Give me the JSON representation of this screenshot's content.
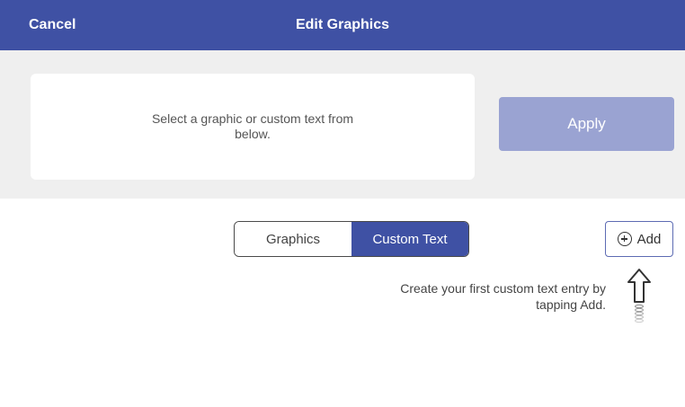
{
  "header": {
    "cancel_label": "Cancel",
    "title": "Edit Graphics"
  },
  "preview": {
    "message": "Select a graphic or custom text from below."
  },
  "apply_label": "Apply",
  "tabs": [
    {
      "label": "Graphics",
      "selected": false
    },
    {
      "label": "Custom Text",
      "selected": true
    }
  ],
  "add_label": "Add",
  "hint": "Create your first custom text entry by tapping Add.",
  "icons": {
    "add": "plus-circle-icon",
    "hint_arrow": "up-arrow-icon"
  },
  "colors": {
    "header": "#3f51a4",
    "apply_disabled": "#9aa3d2",
    "tab_active": "#3f51a4",
    "panel_bg": "#efefef"
  }
}
